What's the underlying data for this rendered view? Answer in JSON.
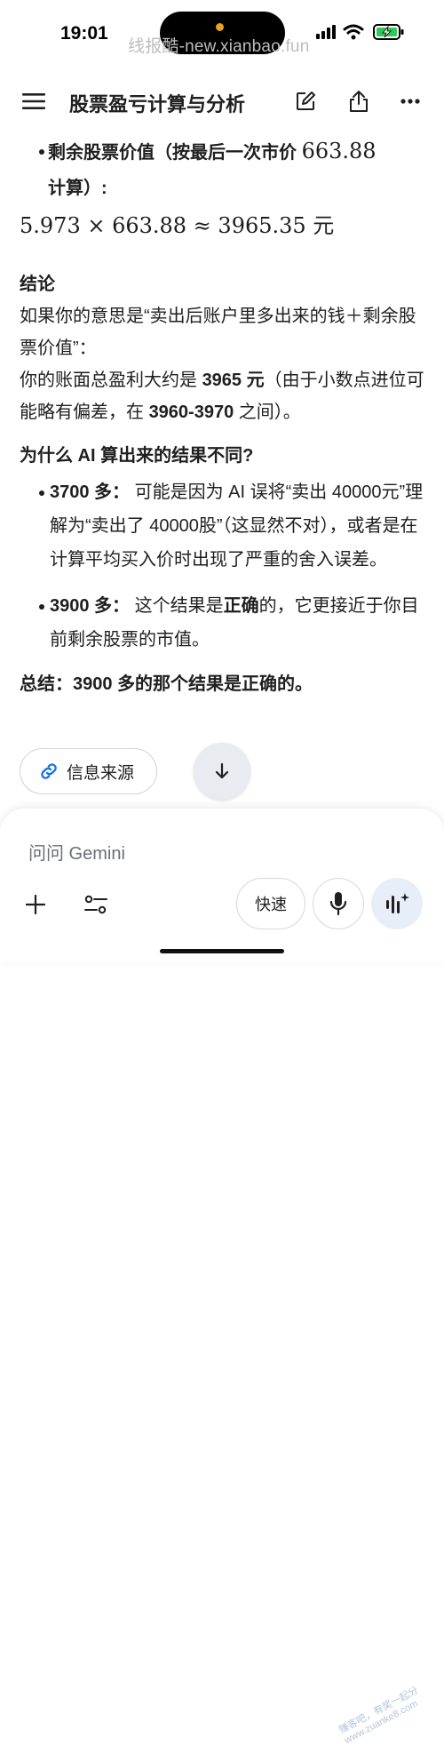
{
  "status": {
    "time": "19:01",
    "watermark": "线报酷-new.xianbao.fun"
  },
  "header": {
    "title": "股票盈亏计算与分析"
  },
  "content": {
    "bullet_remaining": {
      "bold_text": "剩余股票价值（按最后一次市价",
      "price": "663.88",
      "bold_tail": "计算）:"
    },
    "formula": "5.973 × 663.88 ≈ 3965.35 元",
    "conclusion_title": "结论",
    "conclusion_p1": "如果你的意思是“卖出后账户里多出来的钱＋剩余股票价值”：",
    "conclusion_p2_prefix": "你的账面总盈利大约是 ",
    "conclusion_p2_bold1": "3965 元",
    "conclusion_p2_mid": "（由于小数点进位可能略有偏差，在 ",
    "conclusion_p2_bold2": "3960-3970",
    "conclusion_p2_suffix": " 之间）。",
    "why_title": "为什么 AI 算出来的结果不同?",
    "item1_bold": "3700 多：",
    "item1_text": " 可能是因为 AI 误将“卖出 40000元”理解为“卖出了 40000股”（这显然不对），或者是在计算平均买入价时出现了严重的舍入误差。",
    "item2_bold": "3900 多：",
    "item2_text_a": " 这个结果是",
    "item2_text_bold": "正确",
    "item2_text_b": "的，它更接近于你目前剩余股票的市值。",
    "summary": "总结：3900 多的那个结果是正确的。"
  },
  "actions": {
    "sources_label": "信息来源"
  },
  "composer": {
    "placeholder": "问问 Gemini",
    "fast_label": "快速"
  },
  "corner_watermark": "赚客吧，有奖一起分 www.zuanke8.com",
  "icons": {
    "menu": "menu-icon",
    "edit": "edit-icon",
    "share": "share-icon",
    "more": "more-icon",
    "link": "link-icon",
    "scroll": "arrow-down-icon",
    "add": "plus-icon",
    "tools": "tools-icon",
    "mic": "mic-icon",
    "live": "live-icon"
  },
  "colors": {
    "accent_blue": "#1a73e8",
    "battery_green": "#34c759"
  }
}
